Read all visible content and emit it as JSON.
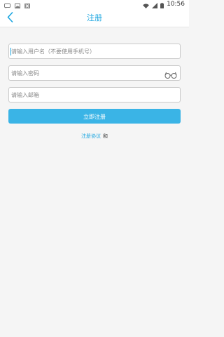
{
  "status_bar": {
    "time": "10:56",
    "left_icons": [
      "message-icon",
      "image-icon",
      "close-box-icon"
    ],
    "right_icons": [
      "wifi-icon",
      "signal-icon",
      "battery-icon"
    ]
  },
  "header": {
    "title": "注册",
    "back_icon": "chevron-left-icon"
  },
  "form": {
    "username_placeholder": "请输入用户名（不要使用手机号）",
    "password_placeholder": "请输入密码",
    "email_placeholder": "请输入邮箱",
    "password_toggle_icon": "glasses-icon",
    "submit_label": "立即注册"
  },
  "agreement": {
    "link_label": "注册协议",
    "and_label": "和"
  },
  "colors": {
    "accent": "#1aa5e0",
    "button": "#3ab4e6",
    "background": "#f5f5f5",
    "border": "#c9c9c9"
  }
}
